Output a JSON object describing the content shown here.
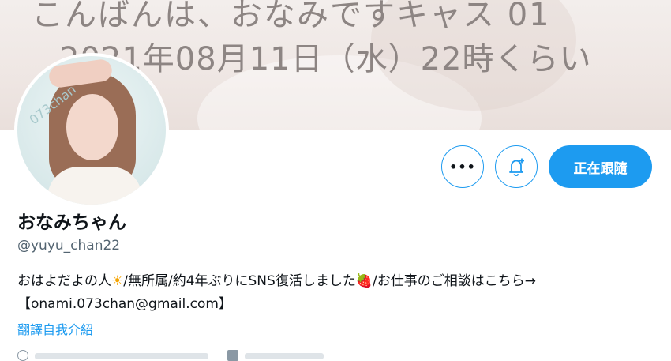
{
  "banner": {
    "line1": "こんばんは、おなみですキャス 01",
    "line2": "2021年08月11日（水）22時くらい"
  },
  "avatar": {
    "watermark": "073chan"
  },
  "actions": {
    "more_label": "•••",
    "follow_label": "正在跟隨"
  },
  "profile": {
    "name": "おなみちゃん",
    "handle": "@yuyu_chan22",
    "bio_part1": "おはよだよの人",
    "bio_emoji1": "☀",
    "bio_part2": "/無所属/約4年ぶりにSNS復活しました",
    "bio_emoji2": "🍓",
    "bio_part3": "/お仕事のご相談はこちら→【onami.073chan@gmail.com】",
    "translate_label": "翻譯自我介紹"
  },
  "colors": {
    "accent": "#1d9bf0",
    "text_primary": "#0f1419",
    "text_secondary": "#536471"
  },
  "icons": {
    "more": "more-horizontal-icon",
    "bell": "bell-plus-icon"
  }
}
